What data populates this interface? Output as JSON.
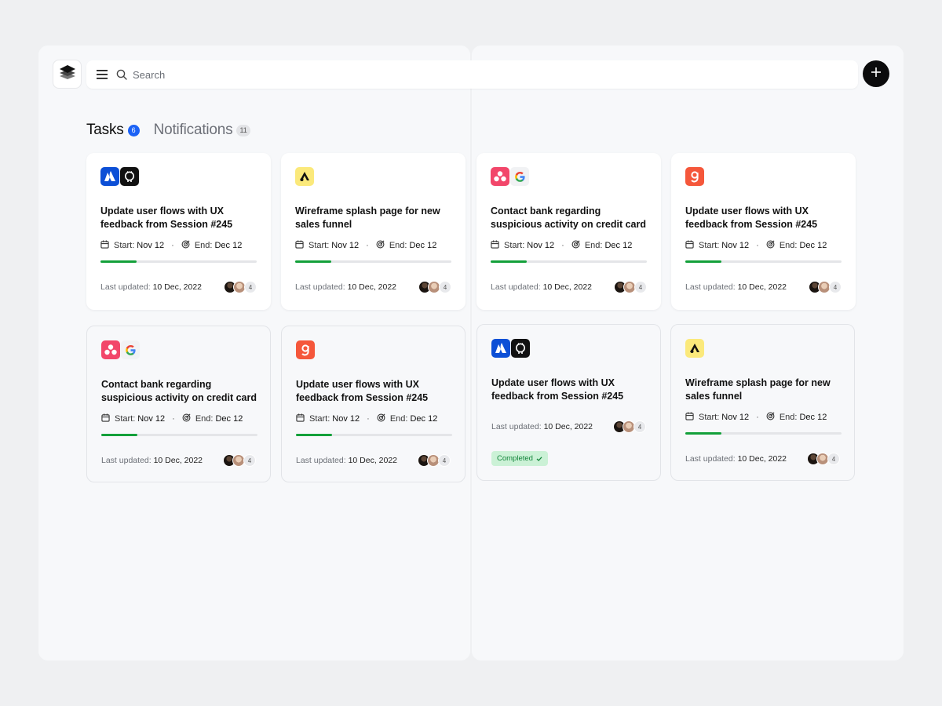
{
  "search": {
    "placeholder": "Search"
  },
  "tabs": [
    {
      "label": "Tasks",
      "count": "6"
    },
    {
      "label": "Notifications",
      "count": "11"
    }
  ],
  "colors": {
    "accent": "#1b62f5",
    "progress": "#13a03a",
    "completed_bg": "#cbf1d6",
    "completed_text": "#12843a"
  },
  "cards": [
    {
      "icons": [
        "atlassian-icon",
        "github-icon"
      ],
      "title": "Update user flows with UX feedback from Session #245",
      "start_label": "Start:",
      "start": "Nov 12",
      "end_label": "End:",
      "end": "Dec 12",
      "progress": 0.23,
      "updated_label": "Last updated:",
      "updated": "10 Dec, 2022",
      "extra_count": "4"
    },
    {
      "icons": [
        "abstract-icon"
      ],
      "title": "Wireframe splash page for new sales funnel",
      "start_label": "Start:",
      "start": "Nov 12",
      "end_label": "End:",
      "end": "Dec 12",
      "progress": 0.23,
      "updated_label": "Last updated:",
      "updated": "10 Dec, 2022",
      "extra_count": "4"
    },
    {
      "icons": [
        "asana-icon",
        "google-icon"
      ],
      "title": "Contact bank regarding suspicious activity on credit card",
      "start_label": "Start:",
      "start": "Nov 12",
      "end_label": "End:",
      "end": "Dec 12",
      "progress": 0.23,
      "updated_label": "Last updated:",
      "updated": "10 Dec, 2022",
      "extra_count": "4"
    },
    {
      "icons": [
        "gumroad-icon"
      ],
      "title": "Update user flows with UX feedback from Session #245",
      "start_label": "Start:",
      "start": "Nov 12",
      "end_label": "End:",
      "end": "Dec 12",
      "progress": 0.23,
      "updated_label": "Last updated:",
      "updated": "10 Dec, 2022",
      "extra_count": "4"
    },
    {
      "icons": [
        "asana-icon",
        "google-icon"
      ],
      "title": "Contact bank regarding suspicious activity on credit card",
      "start_label": "Start:",
      "start": "Nov 12",
      "end_label": "End:",
      "end": "Dec 12",
      "progress": 0.23,
      "updated_label": "Last updated:",
      "updated": "10 Dec, 2022",
      "extra_count": "4"
    },
    {
      "icons": [
        "gumroad-icon"
      ],
      "title": "Update user flows with UX feedback from Session #245",
      "start_label": "Start:",
      "start": "Nov 12",
      "end_label": "End:",
      "end": "Dec 12",
      "progress": 0.23,
      "updated_label": "Last updated:",
      "updated": "10 Dec, 2022",
      "extra_count": "4"
    },
    {
      "icons": [
        "atlassian-icon",
        "github-icon"
      ],
      "title": "Update user flows with UX feedback from Session #245",
      "updated_label": "Last updated:",
      "updated": "10 Dec, 2022",
      "extra_count": "4",
      "status": "Completed"
    },
    {
      "icons": [
        "abstract-icon"
      ],
      "title": "Wireframe splash page for new sales funnel",
      "start_label": "Start:",
      "start": "Nov 12",
      "end_label": "End:",
      "end": "Dec 12",
      "progress": 0.23,
      "updated_label": "Last updated:",
      "updated": "10 Dec, 2022",
      "extra_count": "4"
    }
  ]
}
